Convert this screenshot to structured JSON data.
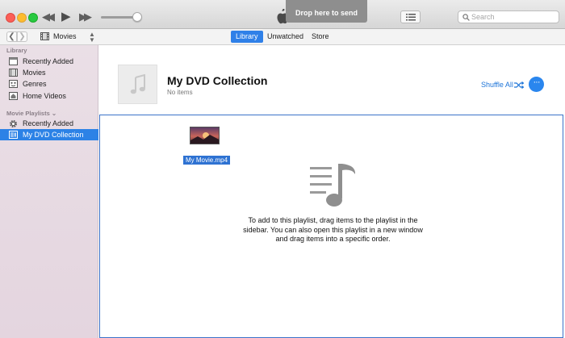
{
  "search": {
    "placeholder": "Search"
  },
  "drop_tooltip": "Drop here to send",
  "navbar": {
    "media_kind": "Movies",
    "tabs": [
      {
        "label": "Library",
        "selected": true
      },
      {
        "label": "Unwatched",
        "selected": false
      },
      {
        "label": "Store",
        "selected": false
      }
    ]
  },
  "sidebar": {
    "library_header": "Library",
    "library_items": [
      {
        "label": "Recently Added",
        "icon": "calendar-icon"
      },
      {
        "label": "Movies",
        "icon": "film-icon"
      },
      {
        "label": "Genres",
        "icon": "genres-icon"
      },
      {
        "label": "Home Videos",
        "icon": "home-icon"
      }
    ],
    "playlists_header": "Movie Playlists",
    "playlist_items": [
      {
        "label": "Recently Added",
        "icon": "gear-icon",
        "selected": false
      },
      {
        "label": "My DVD Collection",
        "icon": "playlist-icon",
        "selected": true
      }
    ]
  },
  "main": {
    "title": "My DVD Collection",
    "subtitle": "No items",
    "shuffle_label": "Shuffle All",
    "more_label": "···",
    "file_name": "My Movie.mp4",
    "hint": "To add to this playlist, drag items to the playlist in the sidebar. You can also open this playlist in a new window and drag items into a specific order."
  },
  "colors": {
    "accent": "#2c82e6",
    "selection": "#2f80e8",
    "sidebar_bg": "#eadfe6",
    "drop_border": "#3b73c9"
  }
}
